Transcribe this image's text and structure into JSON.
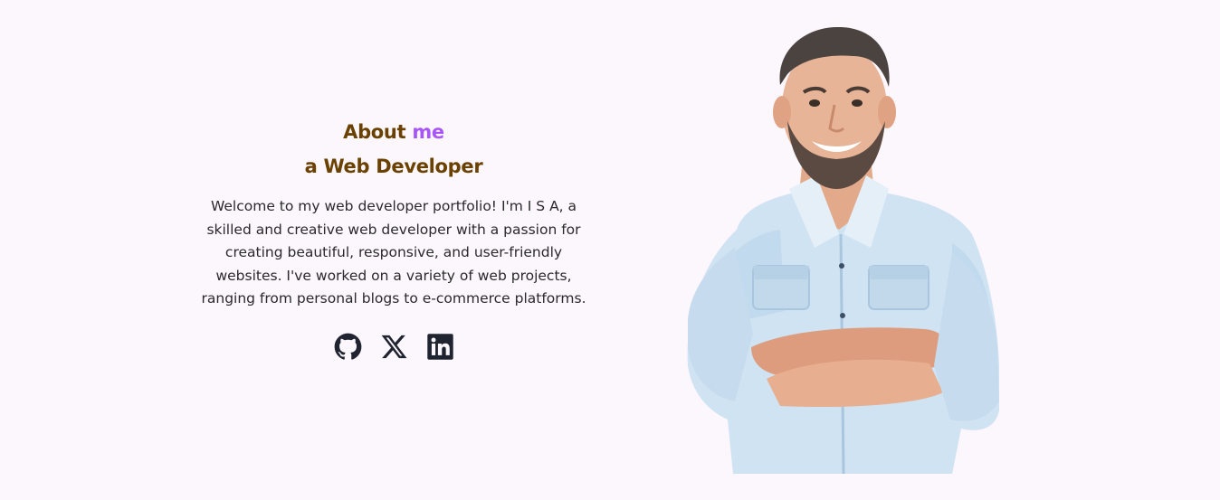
{
  "about": {
    "title_prefix": "About ",
    "title_accent": "me",
    "subtitle": "a Web Developer",
    "description": "Welcome to my web developer portfolio! I'm I S A, a skilled and creative web developer with a passion for creating beautiful, responsive, and user-friendly websites. I've worked on a variety of web projects, ranging from personal blogs to e-commerce platforms."
  },
  "social": [
    {
      "name": "github",
      "icon": "github-icon"
    },
    {
      "name": "x",
      "icon": "x-icon"
    },
    {
      "name": "linkedin",
      "icon": "linkedin-icon"
    }
  ],
  "colors": {
    "background": "#fcf6fd",
    "heading": "#6b4100",
    "accent": "#a855f7",
    "text": "#2a2a2a",
    "icon": "#1f2430",
    "shirt": "#cfe3f2"
  }
}
